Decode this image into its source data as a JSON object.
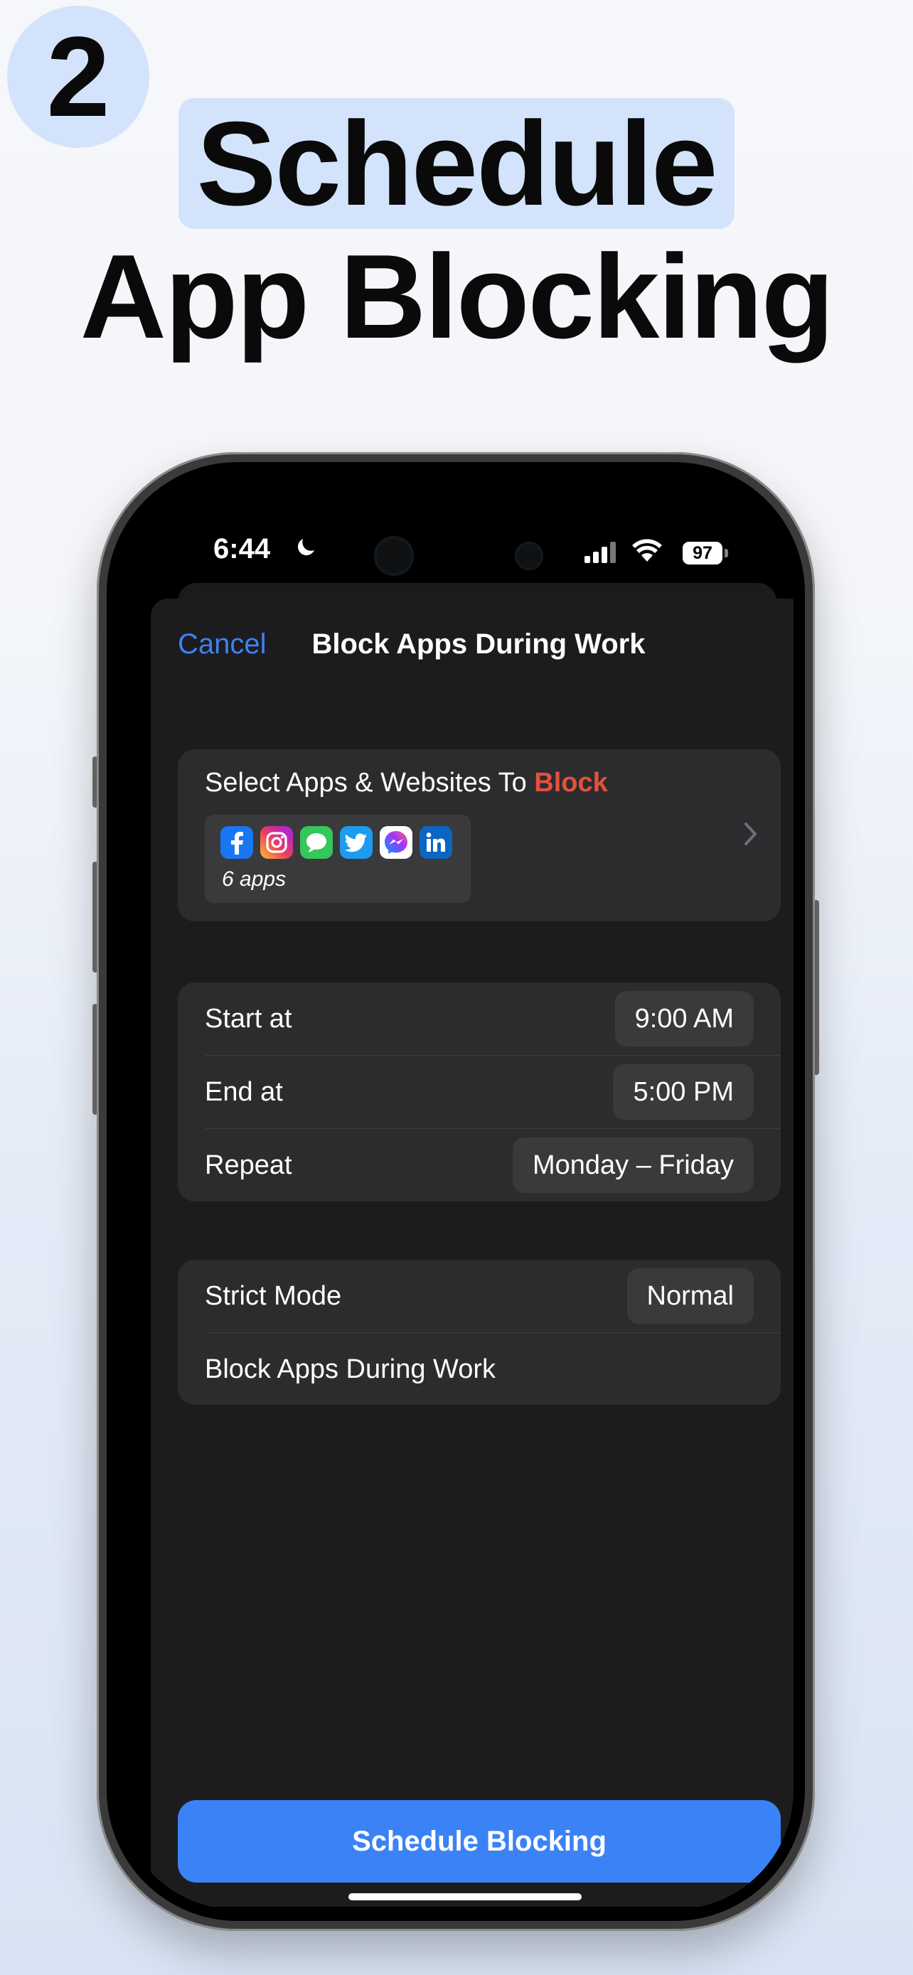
{
  "promo": {
    "step_number": "2",
    "headline_line1": "Schedule",
    "headline_line2": "App Blocking"
  },
  "status_bar": {
    "time": "6:44",
    "battery": "97"
  },
  "sheet": {
    "cancel_label": "Cancel",
    "title": "Block Apps During Work"
  },
  "apps_section": {
    "title_prefix": "Select Apps & Websites To ",
    "title_emphasis": "Block",
    "apps_count": "6 apps",
    "apps": [
      {
        "name": "facebook-icon",
        "glyph": "f",
        "color": "#1877f2"
      },
      {
        "name": "instagram-icon",
        "glyph": "",
        "color": "#d6249f"
      },
      {
        "name": "messages-icon",
        "glyph": "",
        "color": "#34c759"
      },
      {
        "name": "twitter-icon",
        "glyph": "",
        "color": "#1d9bf0"
      },
      {
        "name": "messenger-icon",
        "glyph": "",
        "color": "#ffffff"
      },
      {
        "name": "linkedin-icon",
        "glyph": "in",
        "color": "#0a66c2"
      }
    ]
  },
  "schedule": {
    "start_label": "Start at",
    "start_value": "9:00 AM",
    "end_label": "End at",
    "end_value": "5:00 PM",
    "repeat_label": "Repeat",
    "repeat_value": "Monday – Friday"
  },
  "options": {
    "strict_label": "Strict Mode",
    "strict_value": "Normal",
    "name_value": "Block Apps During Work"
  },
  "cta_label": "Schedule Blocking",
  "colors": {
    "accent": "#3b82f6",
    "block_red": "#e5503c",
    "sheet_bg": "#1c1c1e",
    "group_bg": "#2c2c2e"
  }
}
